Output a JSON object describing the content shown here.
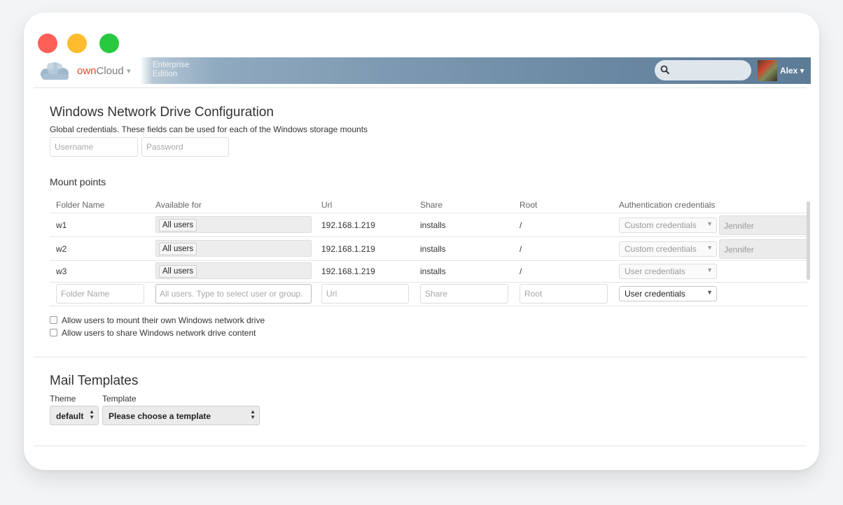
{
  "header": {
    "brand_own": "own",
    "brand_cloud": "Cloud",
    "brand_caret": "▾",
    "edition_line1": "Enterprise",
    "edition_line2": "Edition",
    "user_name": "Alex ▾"
  },
  "wnd": {
    "title": "Windows Network Drive Configuration",
    "description": "Global credentials. These fields can be used for each of the Windows storage mounts",
    "username_placeholder": "Username",
    "password_placeholder": "Password"
  },
  "mounts": {
    "title": "Mount points",
    "columns": [
      "Folder Name",
      "Available for",
      "Url",
      "Share",
      "Root",
      "Authentication credentials"
    ],
    "rows": [
      {
        "folder": "w1",
        "available": "All users",
        "url": "192.168.1.219",
        "share": "installs",
        "root": "/",
        "auth": "Custom credentials",
        "cred": "Jennifer"
      },
      {
        "folder": "w2",
        "available": "All users",
        "url": "192.168.1.219",
        "share": "installs",
        "root": "/",
        "auth": "Custom credentials",
        "cred": "Jennifer"
      },
      {
        "folder": "w3",
        "available": "All users",
        "url": "192.168.1.219",
        "share": "installs",
        "root": "/",
        "auth": "User credentials",
        "cred": ""
      }
    ],
    "new_row": {
      "folder_placeholder": "Folder Name",
      "available_placeholder": "All users. Type to select user or group.",
      "url_placeholder": "Url",
      "share_placeholder": "Share",
      "root_placeholder": "Root",
      "auth_selected": "User credentials"
    },
    "options": {
      "allow_mount": "Allow users to mount their own Windows network drive",
      "allow_share": "Allow users to share Windows network drive content"
    }
  },
  "mail": {
    "title": "Mail Templates",
    "theme_label": "Theme",
    "template_label": "Template",
    "theme_value": "default",
    "template_value": "Please choose a template"
  },
  "colors": {
    "brand": "#e0492b",
    "header_start": "#b7c9d7",
    "header_end": "#5c7b96"
  }
}
